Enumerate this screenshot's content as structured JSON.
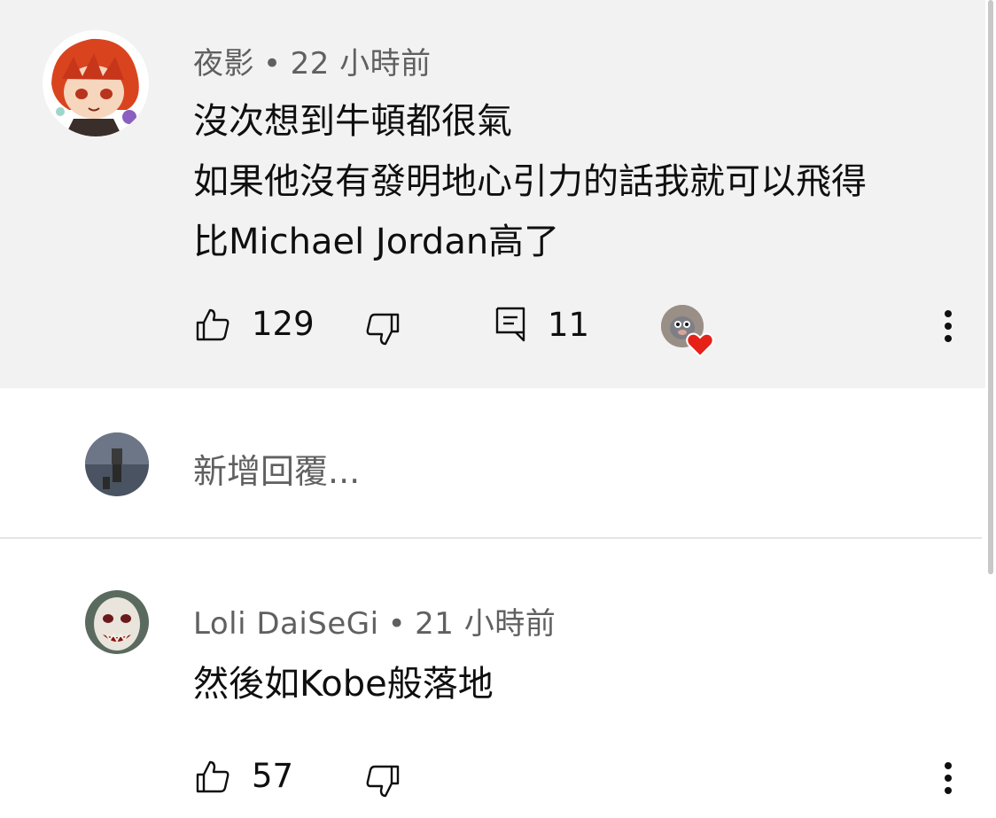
{
  "comments": [
    {
      "author": "夜影",
      "separator": "•",
      "time": "22 小時前",
      "lines": [
        "沒次想到牛頓都很氣",
        "如果他沒有發明地心引力的話我就可以飛得",
        "比Michael  Jordan高了"
      ],
      "likes": "129",
      "replies": "11",
      "creator_hearted": true
    },
    {
      "author": "Loli DaiSeGi",
      "separator": "•",
      "time": "21 小時前",
      "lines": [
        "然後如Kobe般落地"
      ],
      "likes": "57"
    }
  ],
  "reply_box": {
    "placeholder": "新增回覆..."
  },
  "icons": {
    "like": "thumbs-up-icon",
    "dislike": "thumbs-down-icon",
    "reply": "comment-icon",
    "more": "more-vertical-icon",
    "heart": "heart-icon"
  },
  "colors": {
    "highlight_bg": "#f2f2f2",
    "meta_text": "#606060",
    "heart": "#e62117"
  }
}
